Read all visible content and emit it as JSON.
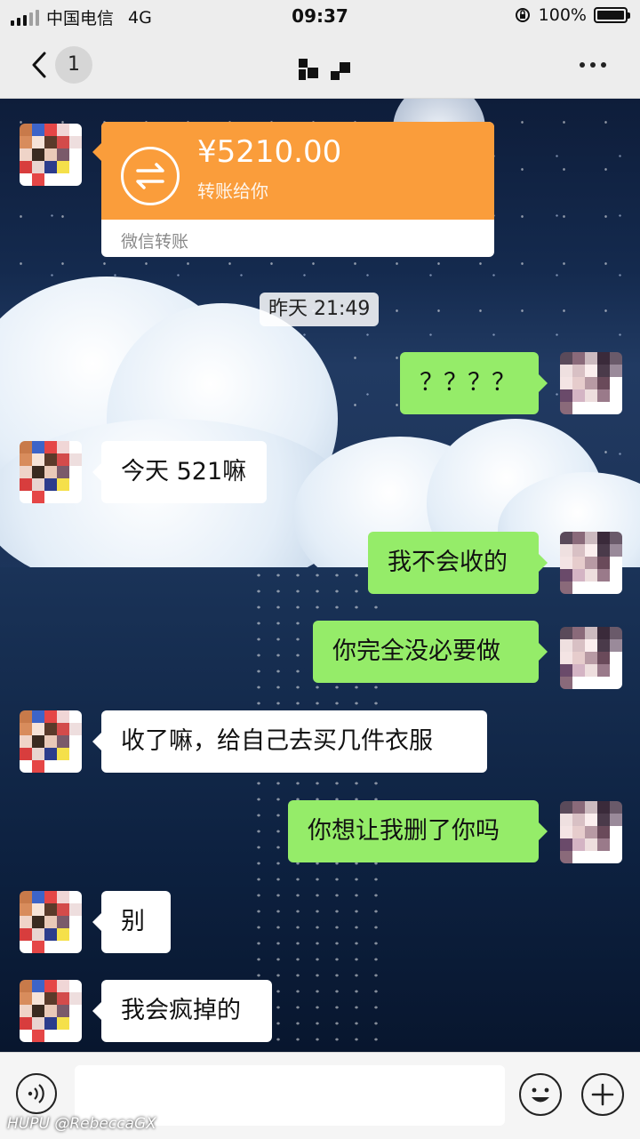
{
  "status_bar": {
    "carrier": "中国电信",
    "network": "4G",
    "time": "09:37",
    "battery": "100%"
  },
  "nav": {
    "unread_count": "1"
  },
  "messages": {
    "transfer": {
      "amount": "¥5210.00",
      "subtitle": "转账给你",
      "footer": "微信转账"
    },
    "timestamp": "昨天 21:49",
    "m1": "？？？？",
    "m2": "今天 521嘛",
    "m3": "我不会收的",
    "m4": "你完全没必要做",
    "m5": "收了嘛，给自己去买几件衣服",
    "m6": "你想让我删了你吗",
    "m7": "别",
    "m8": "我会疯掉的"
  },
  "watermark": "HUPU @RebeccaGX",
  "colors": {
    "outgoing_bubble": "#95ec69",
    "incoming_bubble": "#ffffff",
    "transfer_card": "#fa9d3b"
  }
}
